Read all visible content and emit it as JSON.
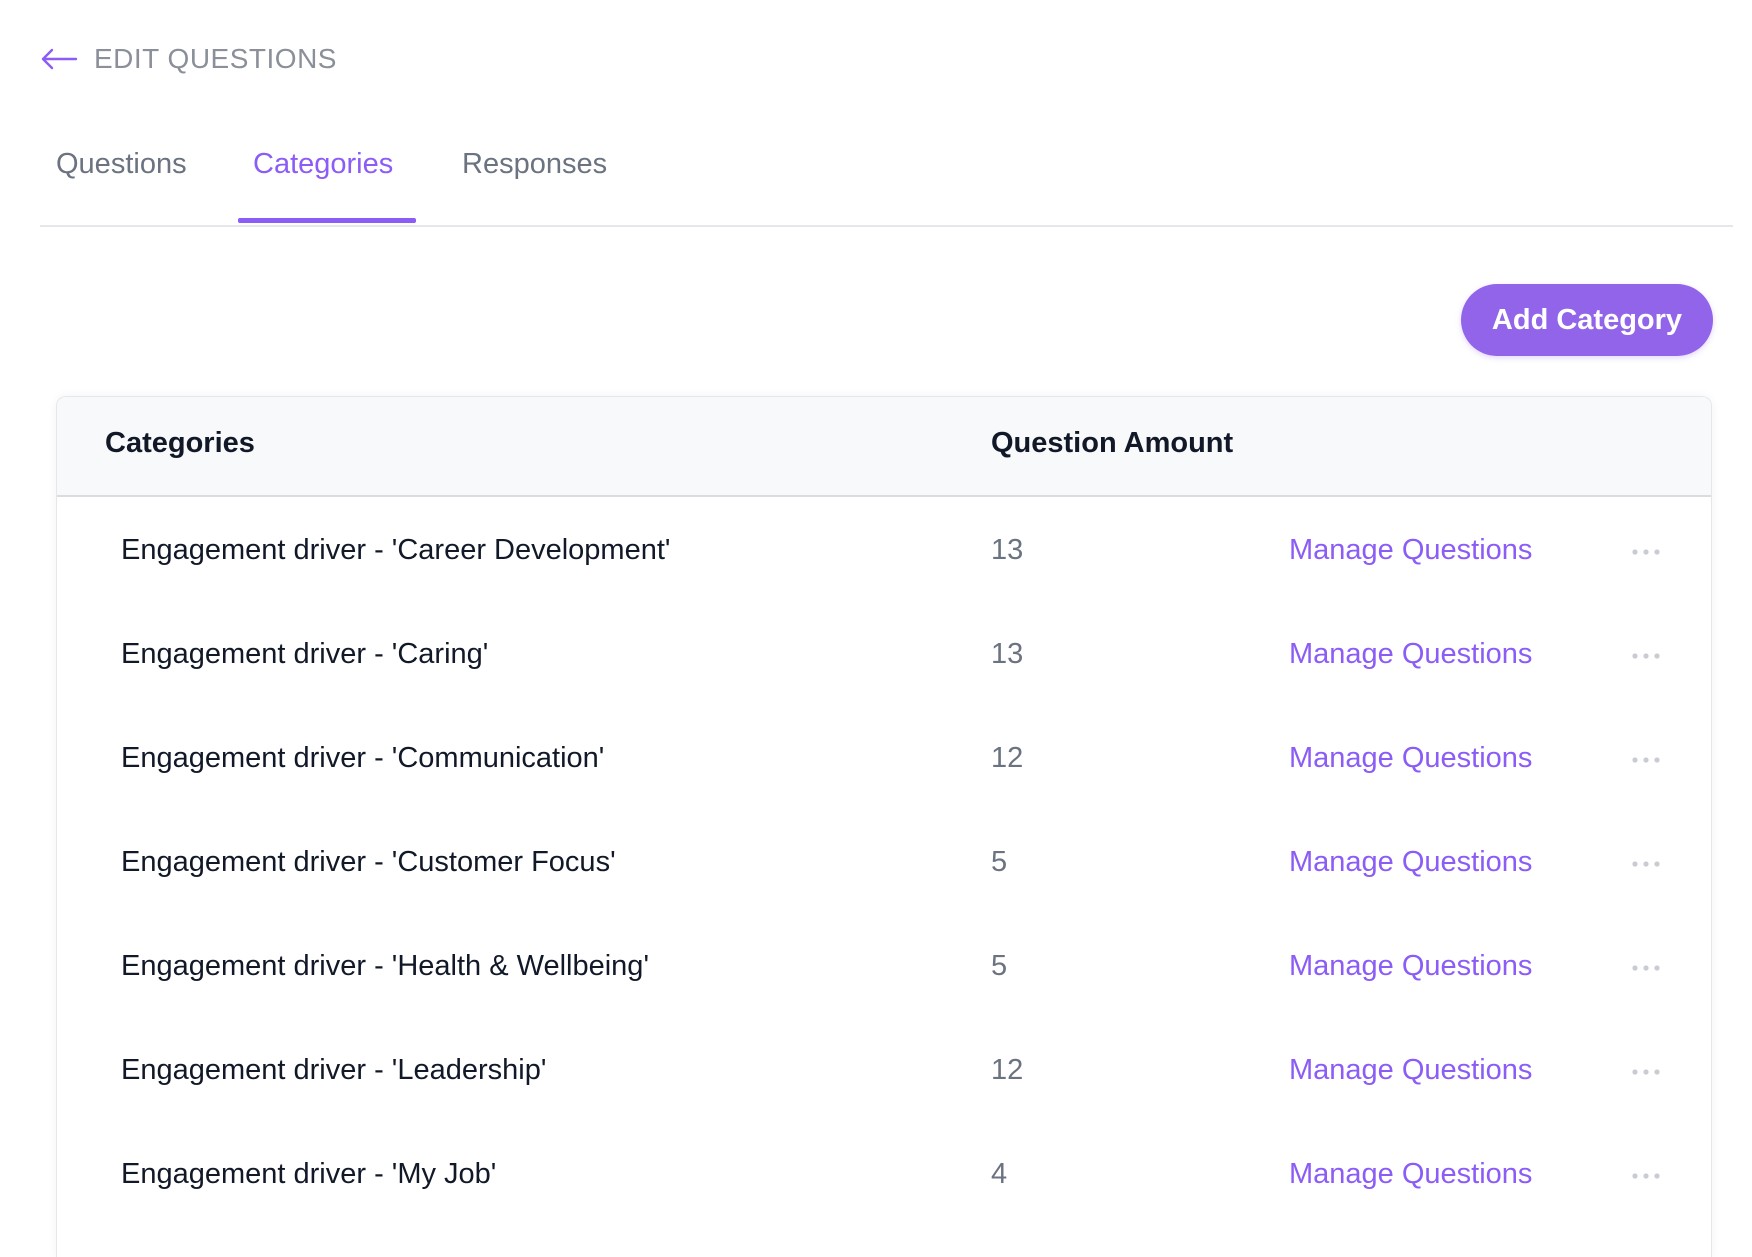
{
  "header": {
    "back_icon": "arrow-left-icon",
    "title": "EDIT QUESTIONS"
  },
  "tabs": [
    {
      "label": "Questions",
      "active": false
    },
    {
      "label": "Categories",
      "active": true
    },
    {
      "label": "Responses",
      "active": false
    }
  ],
  "toolbar": {
    "add_label": "Add Category"
  },
  "table": {
    "columns": [
      "Categories",
      "Question Amount"
    ],
    "rows": [
      {
        "name": "Engagement driver - 'Career Development'",
        "amount": "13",
        "action": "Manage Questions",
        "menu_icon": "more-horizontal-icon"
      },
      {
        "name": "Engagement driver - 'Caring'",
        "amount": "13",
        "action": "Manage Questions",
        "menu_icon": "more-horizontal-icon"
      },
      {
        "name": "Engagement driver - 'Communication'",
        "amount": "12",
        "action": "Manage Questions",
        "menu_icon": "more-horizontal-icon"
      },
      {
        "name": "Engagement driver - 'Customer Focus'",
        "amount": "5",
        "action": "Manage Questions",
        "menu_icon": "more-horizontal-icon"
      },
      {
        "name": "Engagement driver - 'Health & Wellbeing'",
        "amount": "5",
        "action": "Manage Questions",
        "menu_icon": "more-horizontal-icon"
      },
      {
        "name": "Engagement driver - 'Leadership'",
        "amount": "12",
        "action": "Manage Questions",
        "menu_icon": "more-horizontal-icon"
      },
      {
        "name": "Engagement driver - 'My Job'",
        "amount": "4",
        "action": "Manage Questions",
        "menu_icon": "more-horizontal-icon"
      }
    ]
  },
  "colors": {
    "accent": "#8b5cf6",
    "button": "#9164ea",
    "muted_text": "#6b7280",
    "header_bg": "#f8f9fb"
  }
}
